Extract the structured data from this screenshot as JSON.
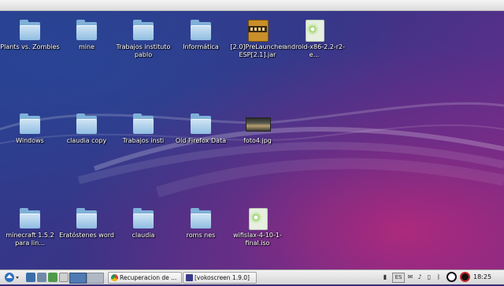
{
  "desktop": {
    "icons": [
      {
        "label": "Plants vs. Zombies",
        "icon": "folder-icon"
      },
      {
        "label": "mine",
        "icon": "folder-icon"
      },
      {
        "label": "Trabajos instituto pablo",
        "icon": "folder-icon"
      },
      {
        "label": "Informática",
        "icon": "folder-icon"
      },
      {
        "label": "[2.0]PreLauncher ESP[2.1].jar",
        "icon": "jar-file-icon"
      },
      {
        "label": "android-x86-2.2-r2-e...",
        "icon": "disc-image-icon"
      },
      {
        "label": "Windows",
        "icon": "folder-icon"
      },
      {
        "label": "claudia copy",
        "icon": "folder-icon"
      },
      {
        "label": "Trabajos insti",
        "icon": "folder-icon"
      },
      {
        "label": "Old Firefox Data",
        "icon": "folder-icon"
      },
      {
        "label": "foto4.jpg",
        "icon": "image-file-icon"
      },
      {
        "label": "minecraft 1.5.2 para lin...",
        "icon": "folder-icon"
      },
      {
        "label": "Eratóstenes word",
        "icon": "folder-icon"
      },
      {
        "label": "claudia",
        "icon": "folder-icon"
      },
      {
        "label": "roms nes",
        "icon": "folder-icon"
      },
      {
        "label": "wifislax-4-10-1-final.iso",
        "icon": "disc-image-icon"
      }
    ]
  },
  "taskbar": {
    "tasks": [
      {
        "label": "Recuperacion de ...",
        "icon": "chrome-icon"
      },
      {
        "label": "[vokoscreen 1.9.0]",
        "icon": "vokoscreen-icon"
      }
    ],
    "keyboard_layout": "ES",
    "clock": "18:25"
  },
  "colors": {
    "folder": "#8fbde2",
    "taskbar_bg": "#e4e4e4",
    "desktop_accent": "#7d2d86"
  }
}
